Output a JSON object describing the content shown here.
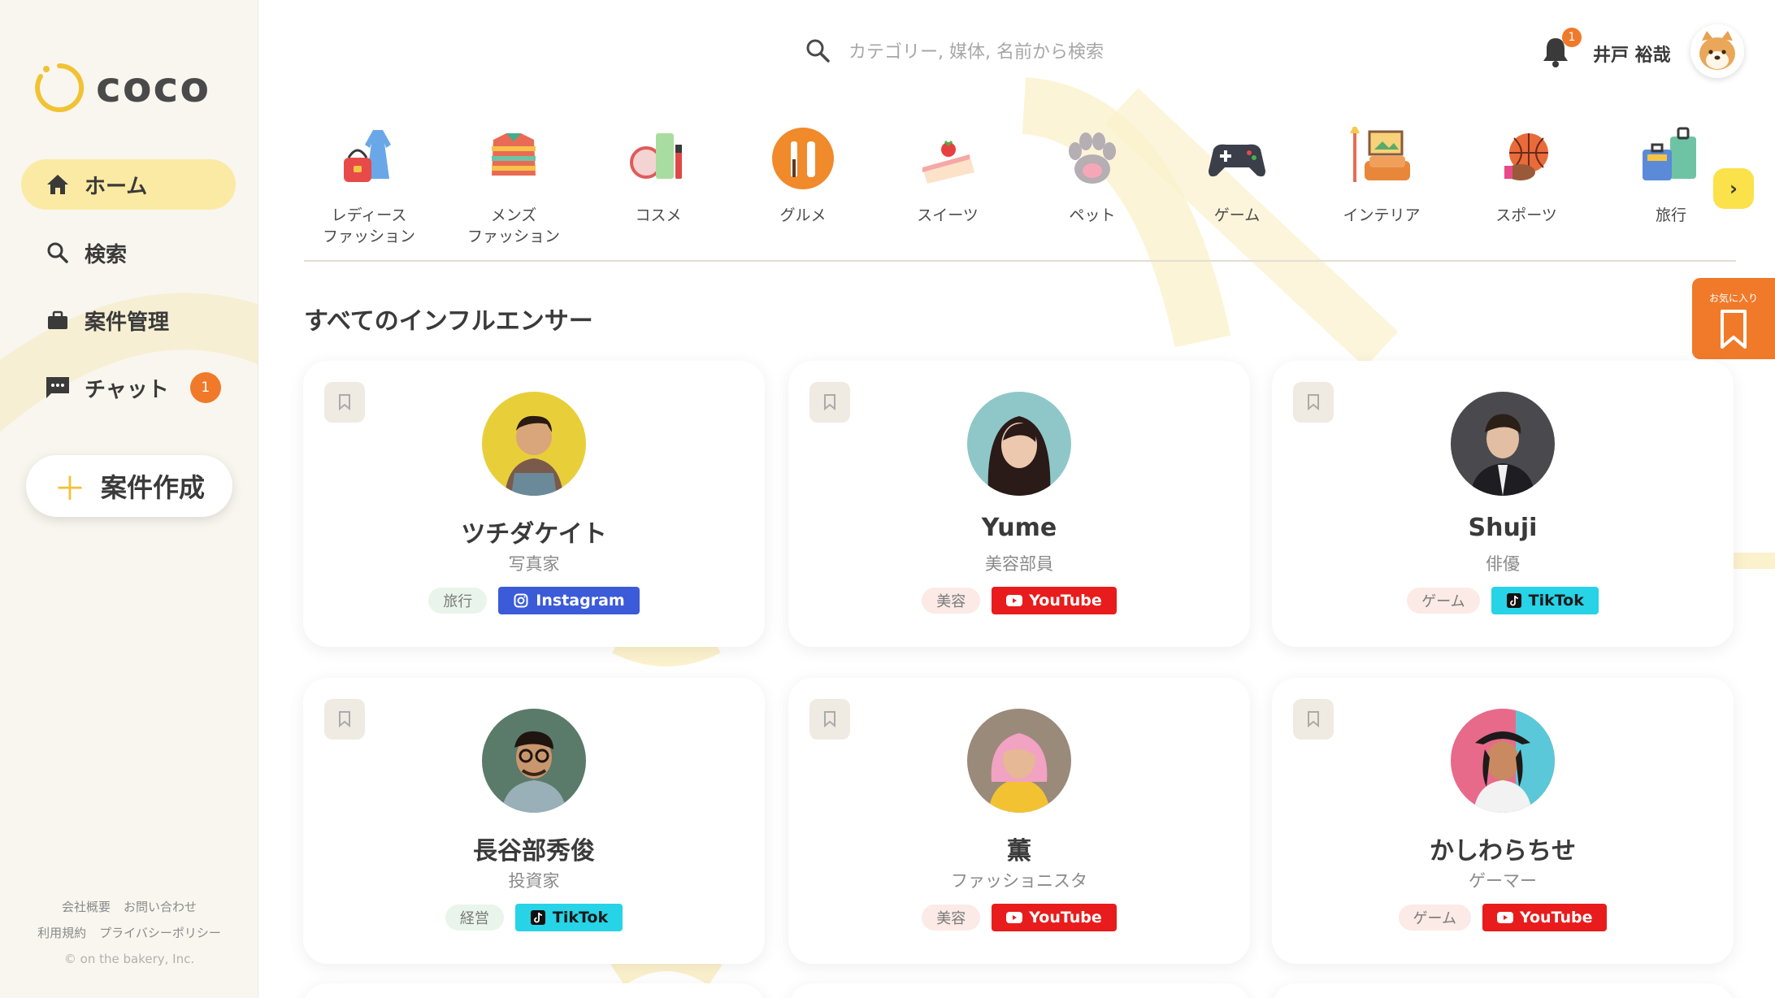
{
  "brand": {
    "name": "coco",
    "accent": "#f1c233"
  },
  "sidebar": {
    "items": [
      {
        "label": "ホーム",
        "icon": "home-icon"
      },
      {
        "label": "検索",
        "icon": "search-icon"
      },
      {
        "label": "案件管理",
        "icon": "briefcase-icon"
      },
      {
        "label": "チャット",
        "icon": "chat-icon",
        "badge": "1"
      }
    ],
    "create_label": "案件作成",
    "footer": {
      "company": "会社概要",
      "contact": "お問い合わせ",
      "terms": "利用規約",
      "privacy": "プライバシーポリシー",
      "copyright": "© on the bakery, Inc."
    }
  },
  "header": {
    "search_placeholder": "カテゴリー, 媒体, 名前から検索",
    "notification_count": "1",
    "user_name": "井戸 裕哉"
  },
  "categories": [
    {
      "label": "レディース\nファッション",
      "icon": "dress-icon"
    },
    {
      "label": "メンズ\nファッション",
      "icon": "shirt-icon"
    },
    {
      "label": "コスメ",
      "icon": "cosmetics-icon"
    },
    {
      "label": "グルメ",
      "icon": "fork-knife-icon"
    },
    {
      "label": "スイーツ",
      "icon": "cake-icon"
    },
    {
      "label": "ペット",
      "icon": "paw-icon"
    },
    {
      "label": "ゲーム",
      "icon": "gamepad-icon"
    },
    {
      "label": "インテリア",
      "icon": "sofa-icon"
    },
    {
      "label": "スポーツ",
      "icon": "ball-icon"
    },
    {
      "label": "旅行",
      "icon": "luggage-icon"
    }
  ],
  "section_title": "すべてのインフルエンサー",
  "favorites_label": "お気に入り",
  "influencers": [
    {
      "name": "ツチダケイト",
      "role": "写真家",
      "tag": "旅行",
      "tag_style": "green",
      "platform": "Instagram",
      "platform_style": "instagram"
    },
    {
      "name": "Yume",
      "role": "美容部員",
      "tag": "美容",
      "tag_style": "pink",
      "platform": "YouTube",
      "platform_style": "youtube"
    },
    {
      "name": "Shuji",
      "role": "俳優",
      "tag": "ゲーム",
      "tag_style": "pink",
      "platform": "TikTok",
      "platform_style": "tiktok"
    },
    {
      "name": "長谷部秀俊",
      "role": "投資家",
      "tag": "経営",
      "tag_style": "green",
      "platform": "TikTok",
      "platform_style": "tiktok"
    },
    {
      "name": "薫",
      "role": "ファッショニスタ",
      "tag": "美容",
      "tag_style": "pink",
      "platform": "YouTube",
      "platform_style": "youtube"
    },
    {
      "name": "かしわらちせ",
      "role": "ゲーマー",
      "tag": "ゲーム",
      "tag_style": "pink",
      "platform": "YouTube",
      "platform_style": "youtube"
    }
  ]
}
